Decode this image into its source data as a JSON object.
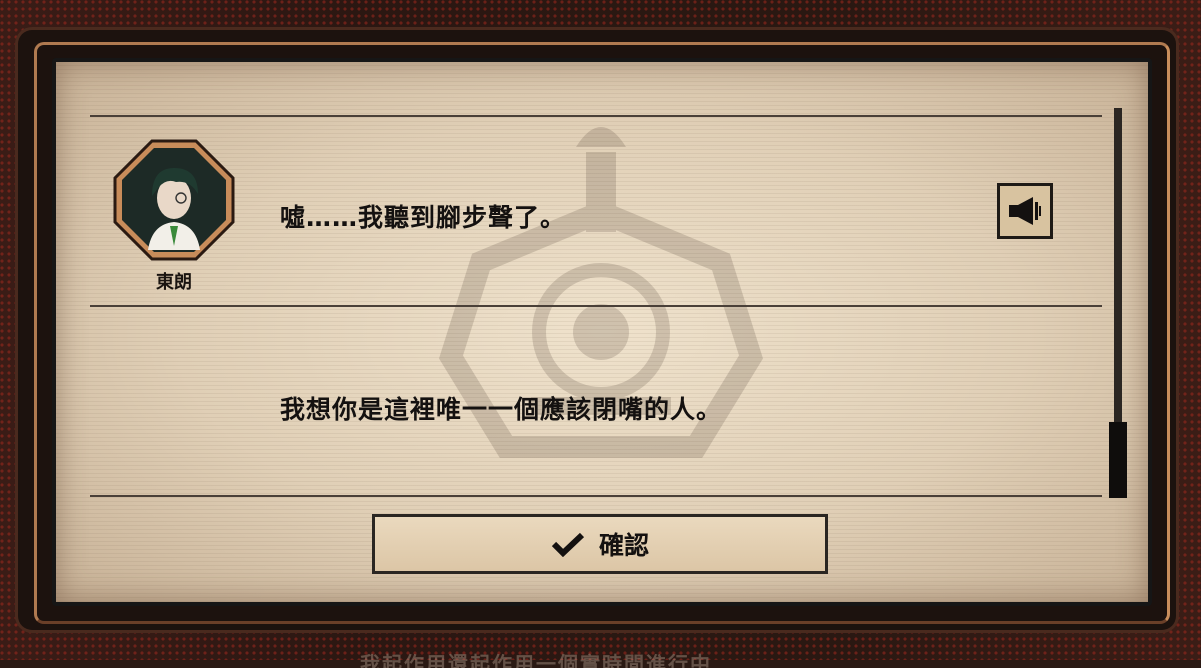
{
  "dialogue": {
    "speaker_name": "東朗",
    "entries": [
      {
        "text": "噓……我聽到腳步聲了。"
      },
      {
        "text": "我想你是這裡唯一一個應該閉嘴的人。"
      }
    ]
  },
  "buttons": {
    "confirm_label": "確認"
  },
  "background_text": "我起作用還起作用一個實時間進行中"
}
